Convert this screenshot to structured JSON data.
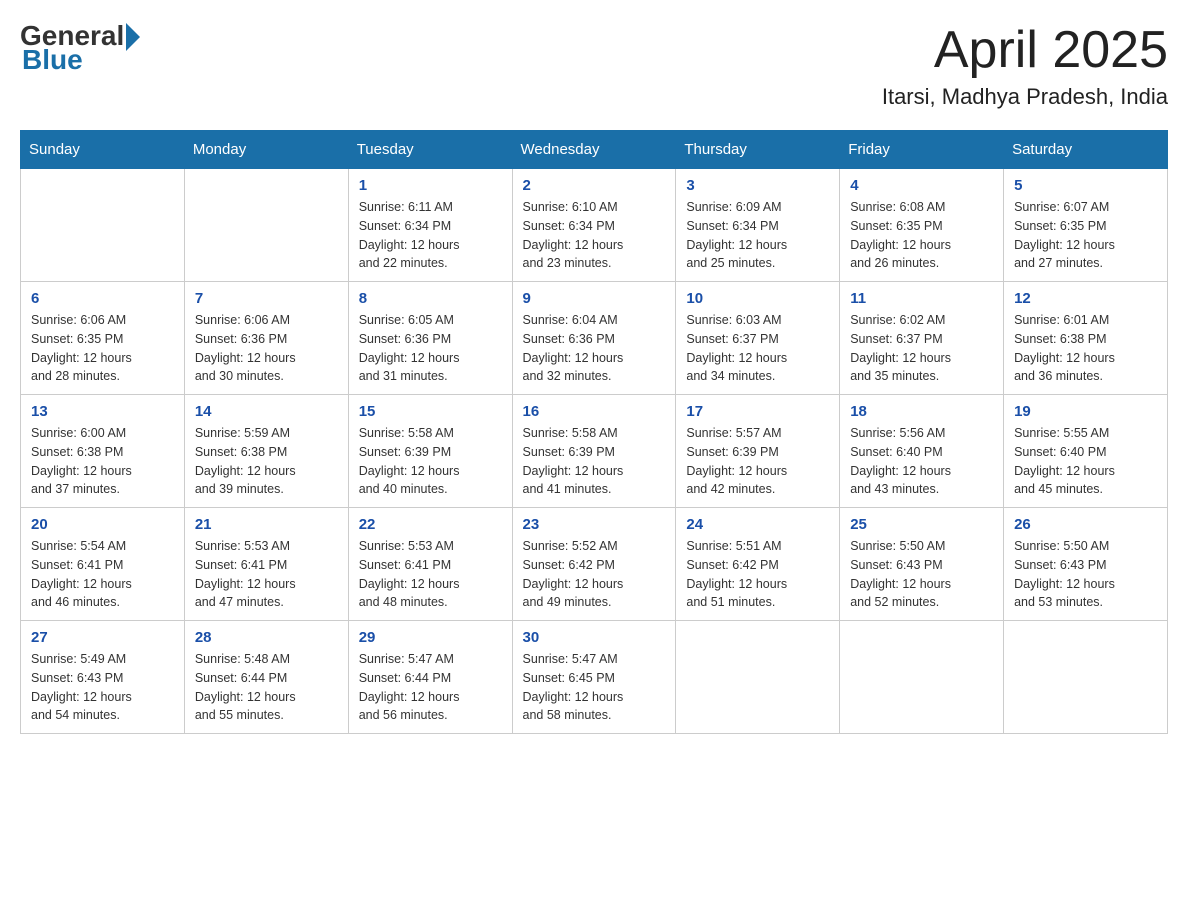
{
  "header": {
    "logo_general": "General",
    "logo_blue": "Blue",
    "month_title": "April 2025",
    "location": "Itarsi, Madhya Pradesh, India"
  },
  "days_of_week": [
    "Sunday",
    "Monday",
    "Tuesday",
    "Wednesday",
    "Thursday",
    "Friday",
    "Saturday"
  ],
  "weeks": [
    [
      {
        "day": "",
        "info": ""
      },
      {
        "day": "",
        "info": ""
      },
      {
        "day": "1",
        "info": "Sunrise: 6:11 AM\nSunset: 6:34 PM\nDaylight: 12 hours\nand 22 minutes."
      },
      {
        "day": "2",
        "info": "Sunrise: 6:10 AM\nSunset: 6:34 PM\nDaylight: 12 hours\nand 23 minutes."
      },
      {
        "day": "3",
        "info": "Sunrise: 6:09 AM\nSunset: 6:34 PM\nDaylight: 12 hours\nand 25 minutes."
      },
      {
        "day": "4",
        "info": "Sunrise: 6:08 AM\nSunset: 6:35 PM\nDaylight: 12 hours\nand 26 minutes."
      },
      {
        "day": "5",
        "info": "Sunrise: 6:07 AM\nSunset: 6:35 PM\nDaylight: 12 hours\nand 27 minutes."
      }
    ],
    [
      {
        "day": "6",
        "info": "Sunrise: 6:06 AM\nSunset: 6:35 PM\nDaylight: 12 hours\nand 28 minutes."
      },
      {
        "day": "7",
        "info": "Sunrise: 6:06 AM\nSunset: 6:36 PM\nDaylight: 12 hours\nand 30 minutes."
      },
      {
        "day": "8",
        "info": "Sunrise: 6:05 AM\nSunset: 6:36 PM\nDaylight: 12 hours\nand 31 minutes."
      },
      {
        "day": "9",
        "info": "Sunrise: 6:04 AM\nSunset: 6:36 PM\nDaylight: 12 hours\nand 32 minutes."
      },
      {
        "day": "10",
        "info": "Sunrise: 6:03 AM\nSunset: 6:37 PM\nDaylight: 12 hours\nand 34 minutes."
      },
      {
        "day": "11",
        "info": "Sunrise: 6:02 AM\nSunset: 6:37 PM\nDaylight: 12 hours\nand 35 minutes."
      },
      {
        "day": "12",
        "info": "Sunrise: 6:01 AM\nSunset: 6:38 PM\nDaylight: 12 hours\nand 36 minutes."
      }
    ],
    [
      {
        "day": "13",
        "info": "Sunrise: 6:00 AM\nSunset: 6:38 PM\nDaylight: 12 hours\nand 37 minutes."
      },
      {
        "day": "14",
        "info": "Sunrise: 5:59 AM\nSunset: 6:38 PM\nDaylight: 12 hours\nand 39 minutes."
      },
      {
        "day": "15",
        "info": "Sunrise: 5:58 AM\nSunset: 6:39 PM\nDaylight: 12 hours\nand 40 minutes."
      },
      {
        "day": "16",
        "info": "Sunrise: 5:58 AM\nSunset: 6:39 PM\nDaylight: 12 hours\nand 41 minutes."
      },
      {
        "day": "17",
        "info": "Sunrise: 5:57 AM\nSunset: 6:39 PM\nDaylight: 12 hours\nand 42 minutes."
      },
      {
        "day": "18",
        "info": "Sunrise: 5:56 AM\nSunset: 6:40 PM\nDaylight: 12 hours\nand 43 minutes."
      },
      {
        "day": "19",
        "info": "Sunrise: 5:55 AM\nSunset: 6:40 PM\nDaylight: 12 hours\nand 45 minutes."
      }
    ],
    [
      {
        "day": "20",
        "info": "Sunrise: 5:54 AM\nSunset: 6:41 PM\nDaylight: 12 hours\nand 46 minutes."
      },
      {
        "day": "21",
        "info": "Sunrise: 5:53 AM\nSunset: 6:41 PM\nDaylight: 12 hours\nand 47 minutes."
      },
      {
        "day": "22",
        "info": "Sunrise: 5:53 AM\nSunset: 6:41 PM\nDaylight: 12 hours\nand 48 minutes."
      },
      {
        "day": "23",
        "info": "Sunrise: 5:52 AM\nSunset: 6:42 PM\nDaylight: 12 hours\nand 49 minutes."
      },
      {
        "day": "24",
        "info": "Sunrise: 5:51 AM\nSunset: 6:42 PM\nDaylight: 12 hours\nand 51 minutes."
      },
      {
        "day": "25",
        "info": "Sunrise: 5:50 AM\nSunset: 6:43 PM\nDaylight: 12 hours\nand 52 minutes."
      },
      {
        "day": "26",
        "info": "Sunrise: 5:50 AM\nSunset: 6:43 PM\nDaylight: 12 hours\nand 53 minutes."
      }
    ],
    [
      {
        "day": "27",
        "info": "Sunrise: 5:49 AM\nSunset: 6:43 PM\nDaylight: 12 hours\nand 54 minutes."
      },
      {
        "day": "28",
        "info": "Sunrise: 5:48 AM\nSunset: 6:44 PM\nDaylight: 12 hours\nand 55 minutes."
      },
      {
        "day": "29",
        "info": "Sunrise: 5:47 AM\nSunset: 6:44 PM\nDaylight: 12 hours\nand 56 minutes."
      },
      {
        "day": "30",
        "info": "Sunrise: 5:47 AM\nSunset: 6:45 PM\nDaylight: 12 hours\nand 58 minutes."
      },
      {
        "day": "",
        "info": ""
      },
      {
        "day": "",
        "info": ""
      },
      {
        "day": "",
        "info": ""
      }
    ]
  ]
}
